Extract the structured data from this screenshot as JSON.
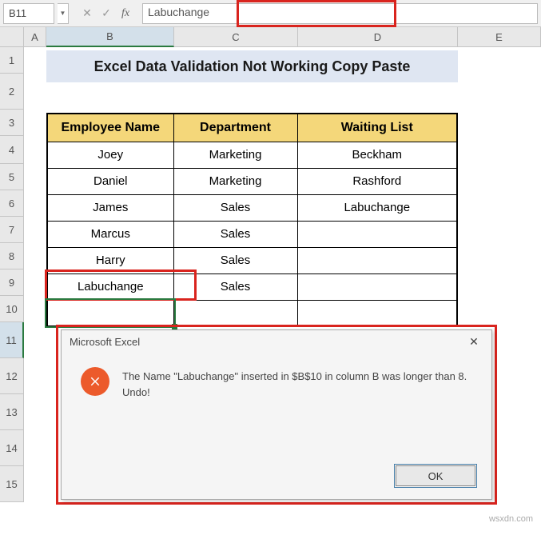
{
  "formula_bar": {
    "name_box": "B11",
    "formula_value": "Labuchange"
  },
  "columns": [
    "A",
    "B",
    "C",
    "D",
    "E"
  ],
  "rows": [
    "1",
    "2",
    "3",
    "4",
    "5",
    "6",
    "7",
    "8",
    "9",
    "10",
    "11",
    "12",
    "13",
    "14",
    "15"
  ],
  "active_row": "11",
  "active_col": "B",
  "title": "Excel Data Validation Not Working Copy Paste",
  "table": {
    "headers": {
      "b": "Employee Name",
      "c": "Department",
      "d": "Waiting List"
    },
    "rows": [
      {
        "b": "Joey",
        "c": "Marketing",
        "d": "Beckham"
      },
      {
        "b": "Daniel",
        "c": "Marketing",
        "d": "Rashford"
      },
      {
        "b": "James",
        "c": "Sales",
        "d": "Labuchange"
      },
      {
        "b": "Marcus",
        "c": "Sales",
        "d": ""
      },
      {
        "b": "Harry",
        "c": "Sales",
        "d": ""
      },
      {
        "b": "Labuchange",
        "c": "Sales",
        "d": ""
      },
      {
        "b": "",
        "c": "",
        "d": ""
      }
    ]
  },
  "dialog": {
    "title": "Microsoft Excel",
    "message": "The Name \"Labuchange\" inserted in $B$10 in column B was longer than 8. Undo!",
    "ok": "OK"
  },
  "watermark": "wsxdn.com"
}
